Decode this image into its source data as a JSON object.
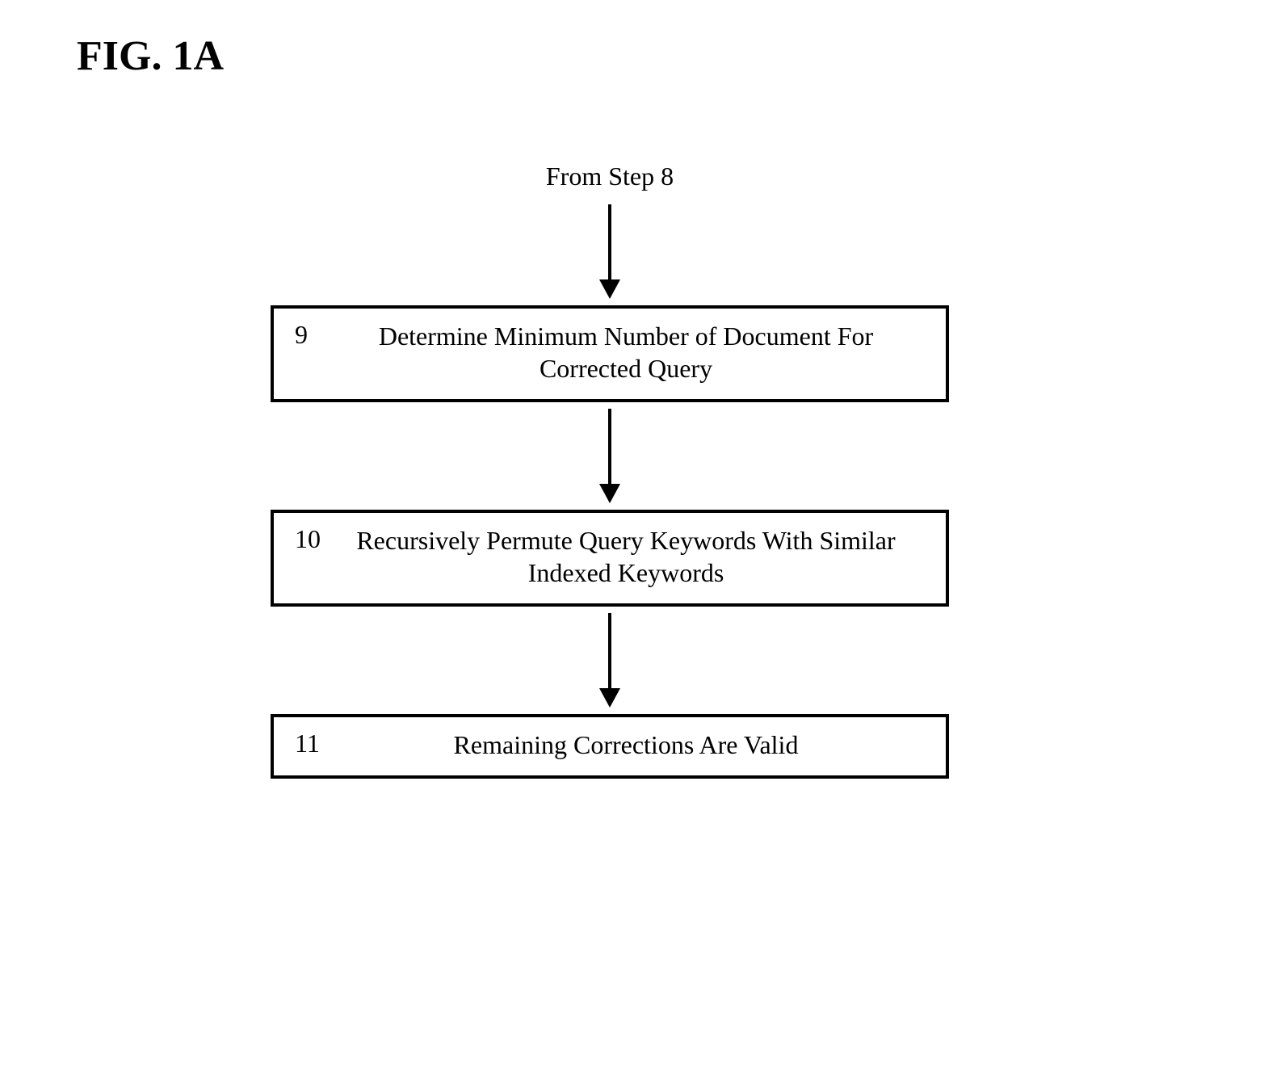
{
  "figure": {
    "title": "FIG. 1A"
  },
  "flowchart": {
    "entry": "From Step 8",
    "steps": [
      {
        "number": "9",
        "text": "Determine Minimum Number of Document For Corrected Query"
      },
      {
        "number": "10",
        "text": "Recursively Permute Query Keywords With Similar Indexed Keywords"
      },
      {
        "number": "11",
        "text": "Remaining Corrections Are Valid"
      }
    ]
  }
}
